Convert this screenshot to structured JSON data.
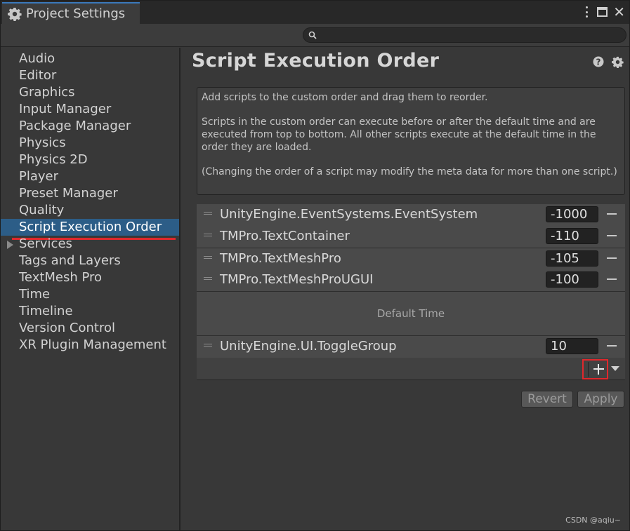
{
  "window": {
    "tab_title": "Project Settings"
  },
  "search": {
    "placeholder": ""
  },
  "sidebar": {
    "items": [
      {
        "label": "Audio"
      },
      {
        "label": "Editor"
      },
      {
        "label": "Graphics"
      },
      {
        "label": "Input Manager"
      },
      {
        "label": "Package Manager"
      },
      {
        "label": "Physics"
      },
      {
        "label": "Physics 2D"
      },
      {
        "label": "Player"
      },
      {
        "label": "Preset Manager"
      },
      {
        "label": "Quality"
      },
      {
        "label": "Script Execution Order",
        "selected": true
      },
      {
        "label": "Services",
        "expandable": true
      },
      {
        "label": "Tags and Layers"
      },
      {
        "label": "TextMesh Pro"
      },
      {
        "label": "Time"
      },
      {
        "label": "Timeline"
      },
      {
        "label": "Version Control"
      },
      {
        "label": "XR Plugin Management"
      }
    ]
  },
  "main": {
    "title": "Script Execution Order",
    "help_text": [
      "Add scripts to the custom order and drag them to reorder.",
      "Scripts in the custom order can execute before or after the default time and are executed from top to bottom. All other scripts execute at the default time in the order they are loaded.",
      "(Changing the order of a script may modify the meta data for more than one script.)"
    ],
    "scripts_before": [
      {
        "name": "UnityEngine.EventSystems.EventSystem",
        "order": "-1000"
      },
      {
        "name": "TMPro.TextContainer",
        "order": "-110"
      },
      {
        "name": "TMPro.TextMeshPro",
        "order": "-105"
      },
      {
        "name": "TMPro.TextMeshProUGUI",
        "order": "-100"
      }
    ],
    "default_time_label": "Default Time",
    "scripts_after": [
      {
        "name": "UnityEngine.UI.ToggleGroup",
        "order": "10"
      }
    ],
    "revert_label": "Revert",
    "apply_label": "Apply"
  },
  "watermark": "CSDN @aqiu~",
  "colors": {
    "selection": "#2c5d87",
    "highlight_red": "#e0282c",
    "tab_accent": "#3a79bb"
  }
}
